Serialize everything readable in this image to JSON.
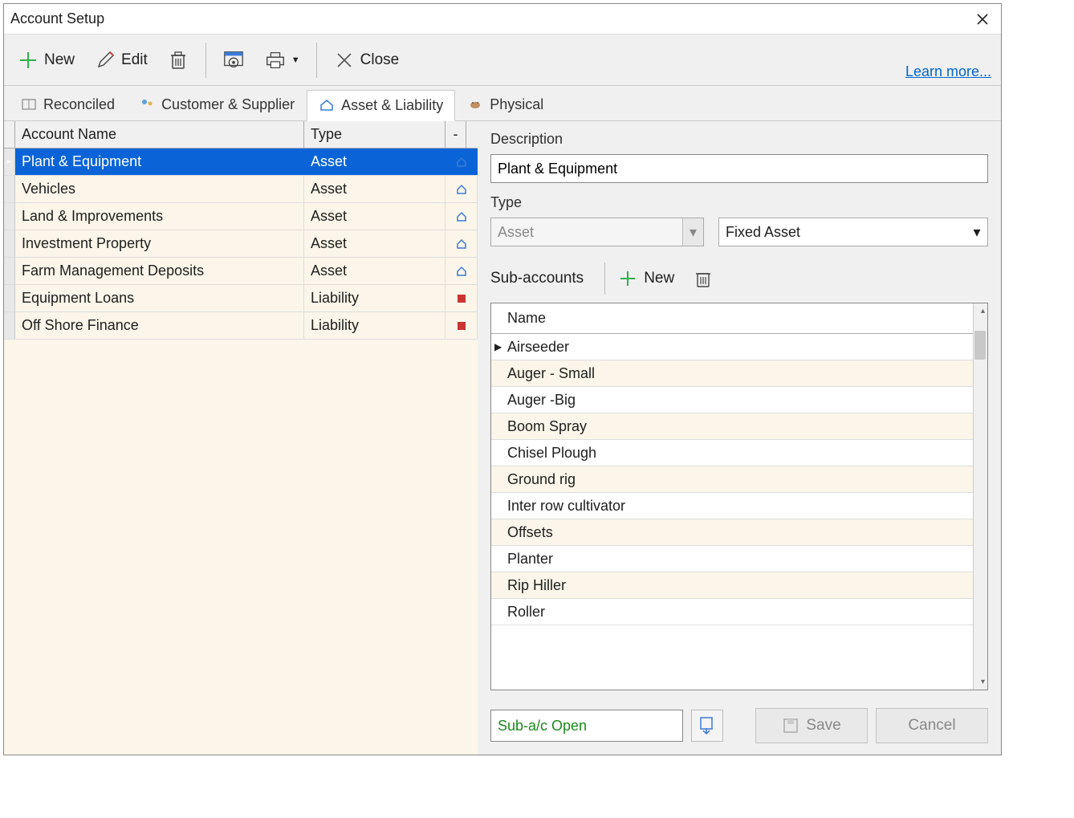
{
  "window": {
    "title": "Account Setup"
  },
  "toolbar": {
    "new_label": "New",
    "edit_label": "Edit",
    "close_label": "Close",
    "learn_more": "Learn more..."
  },
  "tabs": {
    "reconciled": "Reconciled",
    "customer_supplier": "Customer & Supplier",
    "asset_liability": "Asset & Liability",
    "physical": "Physical"
  },
  "left_table": {
    "header_name": "Account Name",
    "header_type": "Type",
    "header_dash": "-",
    "rows": [
      {
        "name": "Plant & Equipment",
        "type": "Asset",
        "selected": true
      },
      {
        "name": "Vehicles",
        "type": "Asset"
      },
      {
        "name": "Land & Improvements",
        "type": "Asset"
      },
      {
        "name": "Investment Property",
        "type": "Asset"
      },
      {
        "name": "Farm Management Deposits",
        "type": "Asset"
      },
      {
        "name": "Equipment Loans",
        "type": "Liability"
      },
      {
        "name": "Off Shore Finance",
        "type": "Liability"
      }
    ]
  },
  "right": {
    "desc_label": "Description",
    "desc_value": "Plant & Equipment",
    "type_label": "Type",
    "type1_value": "Asset",
    "type2_value": "Fixed Asset",
    "sub_label": "Sub-accounts",
    "sub_new_label": "New",
    "sub_header": "Name",
    "sub_rows": [
      "Airseeder",
      "Auger - Small",
      "Auger -Big",
      "Boom Spray",
      "Chisel Plough",
      "Ground rig",
      "Inter row cultivator",
      "Offsets",
      "Planter",
      "Rip Hiller",
      "Roller"
    ],
    "sub_open": "Sub-a/c Open",
    "save_label": "Save",
    "cancel_label": "Cancel"
  }
}
